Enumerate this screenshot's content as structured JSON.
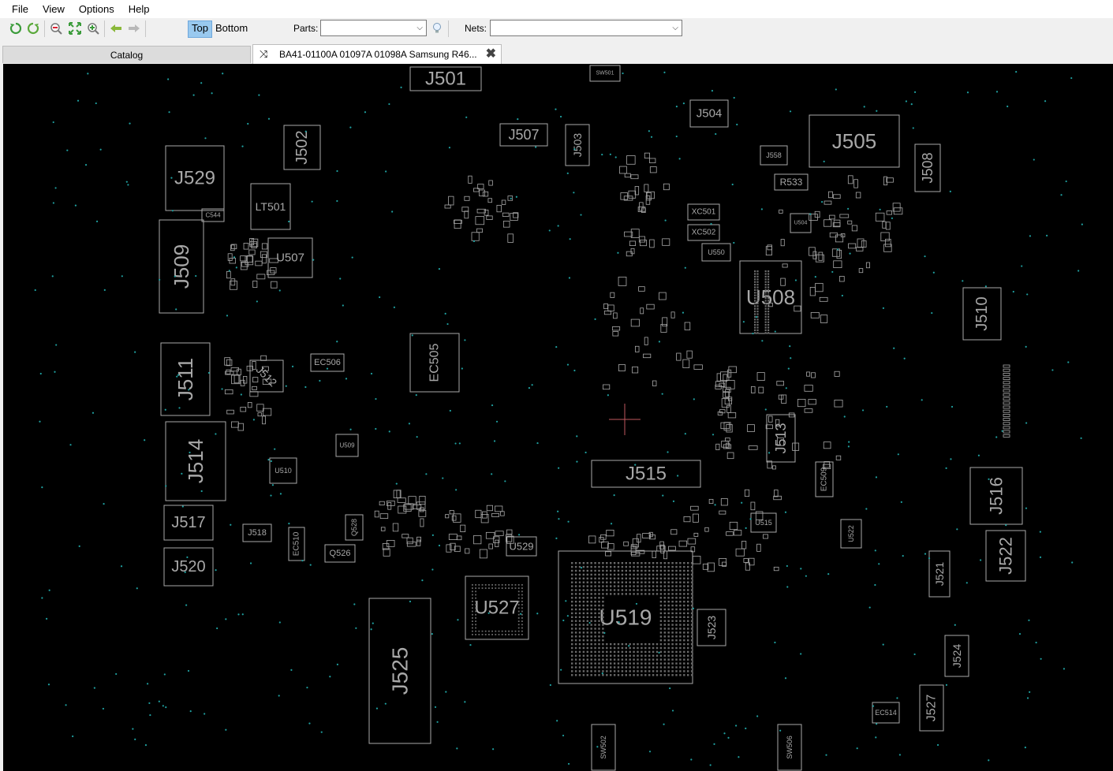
{
  "menu": [
    "File",
    "View",
    "Options",
    "Help"
  ],
  "toolbar": {
    "icons": [
      "refresh-green-icon",
      "refresh-rotate-icon",
      "zoom-out-icon",
      "fit-board-icon",
      "zoom-in-icon",
      "arrow-left-icon",
      "arrow-right-icon"
    ],
    "top_label": "Top",
    "bottom_label": "Bottom",
    "parts_label": "Parts:",
    "parts_value": "",
    "parts_action_icon": "lightbulb-icon",
    "nets_label": "Nets:",
    "nets_value": ""
  },
  "tabs": {
    "catalog_label": "Catalog",
    "document_label": "BA41-01100A 01097A 01098A Samsung R46...",
    "document_icon": "shuffle-icon",
    "close_icon": "close-icon"
  },
  "board": {
    "background": "#000000",
    "outline_color": "#a8a8a8",
    "via_color": "#1fa0a0",
    "crosshair_color": "#c0585e",
    "components": [
      "J501",
      "J502",
      "J503",
      "J504",
      "J505",
      "J507",
      "J508",
      "J509",
      "J510",
      "J511",
      "J512",
      "J513",
      "J514",
      "J515",
      "J516",
      "J517",
      "J518",
      "J520",
      "J521",
      "J522",
      "J523",
      "J524",
      "J525",
      "J527",
      "J529",
      "U504",
      "U507",
      "U508",
      "U509",
      "U510",
      "U515",
      "U519",
      "U522",
      "U527",
      "U529",
      "LT501",
      "EC505",
      "EC506",
      "EC509",
      "EC510",
      "EC514",
      "XC501",
      "XC502",
      "C544",
      "R533",
      "J558",
      "U550",
      "Q526",
      "Q528",
      "SW501",
      "SW502",
      "SW506"
    ]
  }
}
